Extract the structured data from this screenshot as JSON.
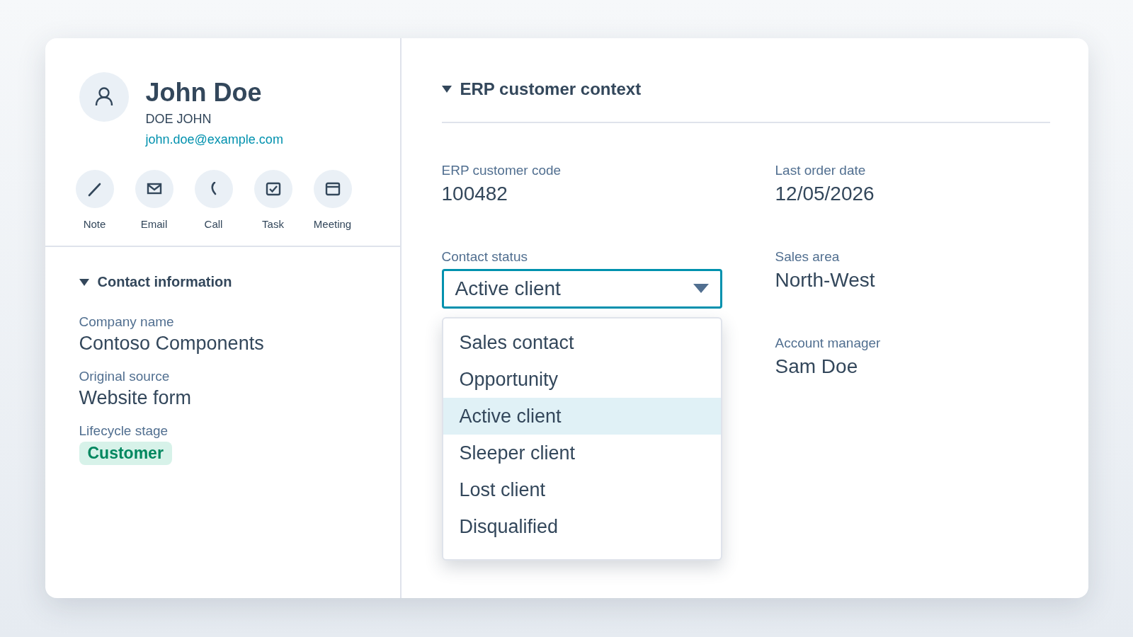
{
  "contact": {
    "name": "John Doe",
    "alt_name": "DOE JOHN",
    "email": "john.doe@example.com"
  },
  "actions": [
    {
      "label": "Note",
      "kind": "note"
    },
    {
      "label": "Email",
      "kind": "email"
    },
    {
      "label": "Call",
      "kind": "call"
    },
    {
      "label": "Task",
      "kind": "task"
    },
    {
      "label": "Meeting",
      "kind": "meeting"
    }
  ],
  "contact_information": {
    "title": "Contact information",
    "expanded": true,
    "fields": [
      {
        "label": "Company name",
        "value": "Contoso Components",
        "kind": "text"
      },
      {
        "label": "Original source",
        "value": "Website form",
        "kind": "text"
      },
      {
        "label": "Lifecycle stage",
        "value": "Customer",
        "kind": "tag"
      }
    ]
  },
  "erp": {
    "title": "ERP customer context",
    "expanded": true,
    "columns": [
      [
        {
          "label": "ERP customer code",
          "value": "100482",
          "kind": "text"
        },
        {
          "label": "Contact status",
          "value": "Active client",
          "kind": "select",
          "open": true,
          "options": [
            {
              "label": "Sales contact",
              "selected": false
            },
            {
              "label": "Opportunity",
              "selected": false
            },
            {
              "label": "Active client",
              "selected": true
            },
            {
              "label": "Sleeper client",
              "selected": false
            },
            {
              "label": "Lost client",
              "selected": false
            },
            {
              "label": "Disqualified",
              "selected": false
            }
          ]
        }
      ],
      [
        {
          "label": "Last order date",
          "value": "12/05/2026",
          "kind": "text"
        },
        {
          "label": "Sales area",
          "value": "North-West",
          "kind": "text"
        },
        {
          "label": "Account manager",
          "value": "Sam Doe",
          "kind": "text"
        }
      ]
    ]
  }
}
